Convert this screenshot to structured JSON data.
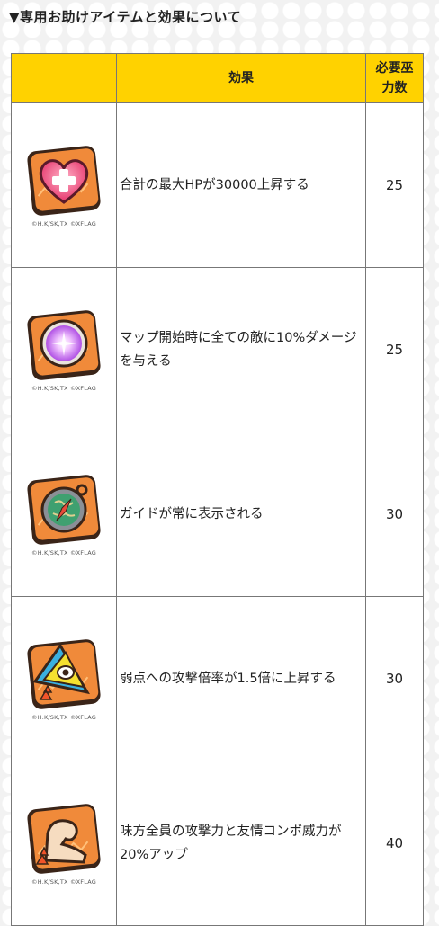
{
  "heading": "▼専用お助けアイテムと効果について",
  "table": {
    "headers": {
      "icon": "",
      "effect": "効果",
      "cost": "必要巫力数"
    },
    "rows": [
      {
        "icon": "heart-plus-item-icon",
        "copyright": "©H.K/SK,TX  ©XFLAG",
        "effect": "合計の最大HPが30000上昇する",
        "cost": "25"
      },
      {
        "icon": "purple-orb-item-icon",
        "copyright": "©H.K/SK,TX  ©XFLAG",
        "effect": "マップ開始時に全ての敵に10%ダメージを与える",
        "cost": "25"
      },
      {
        "icon": "compass-item-icon",
        "copyright": "©H.K/SK,TX  ©XFLAG",
        "effect": "ガイドが常に表示される",
        "cost": "30"
      },
      {
        "icon": "weak-point-triangle-item-icon",
        "copyright": "©H.K/SK,TX  ©XFLAG",
        "effect": "弱点への攻撃倍率が1.5倍に上昇する",
        "cost": "30"
      },
      {
        "icon": "muscle-arm-item-icon",
        "copyright": "©H.K/SK,TX  ©XFLAG",
        "effect": "味方全員の攻撃力と友情コンボ威力が20%アップ",
        "cost": "40"
      }
    ]
  },
  "colors": {
    "header_bg": "#ffd200",
    "tile": "#f08a3a",
    "border": "#777777"
  }
}
